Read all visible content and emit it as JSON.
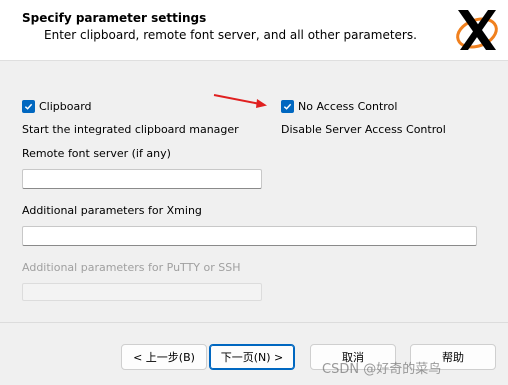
{
  "header": {
    "title": "Specify parameter settings",
    "subtitle": "Enter clipboard, remote font server, and all other parameters.",
    "logo_icon": "xming-x-logo"
  },
  "options": {
    "clipboard": {
      "label": "Clipboard",
      "checked": true,
      "description": "Start the integrated clipboard manager"
    },
    "no_access_control": {
      "label": "No Access Control",
      "checked": true,
      "description": "Disable Server Access Control"
    }
  },
  "fields": {
    "font_server": {
      "label": "Remote font server (if any)",
      "value": ""
    },
    "xming_params": {
      "label": "Additional parameters for Xming",
      "value": ""
    },
    "putty_params": {
      "label": "Additional parameters for PuTTY or SSH",
      "value": ""
    }
  },
  "buttons": {
    "back": "< 上一步(B)",
    "next": "下一页(N) >",
    "cancel": "取消",
    "help": "帮助"
  },
  "watermark": "CSDN @好奇的菜鸟",
  "colors": {
    "accent": "#0067c0",
    "arrow": "#e02020",
    "logo_orange": "#f0801e"
  }
}
